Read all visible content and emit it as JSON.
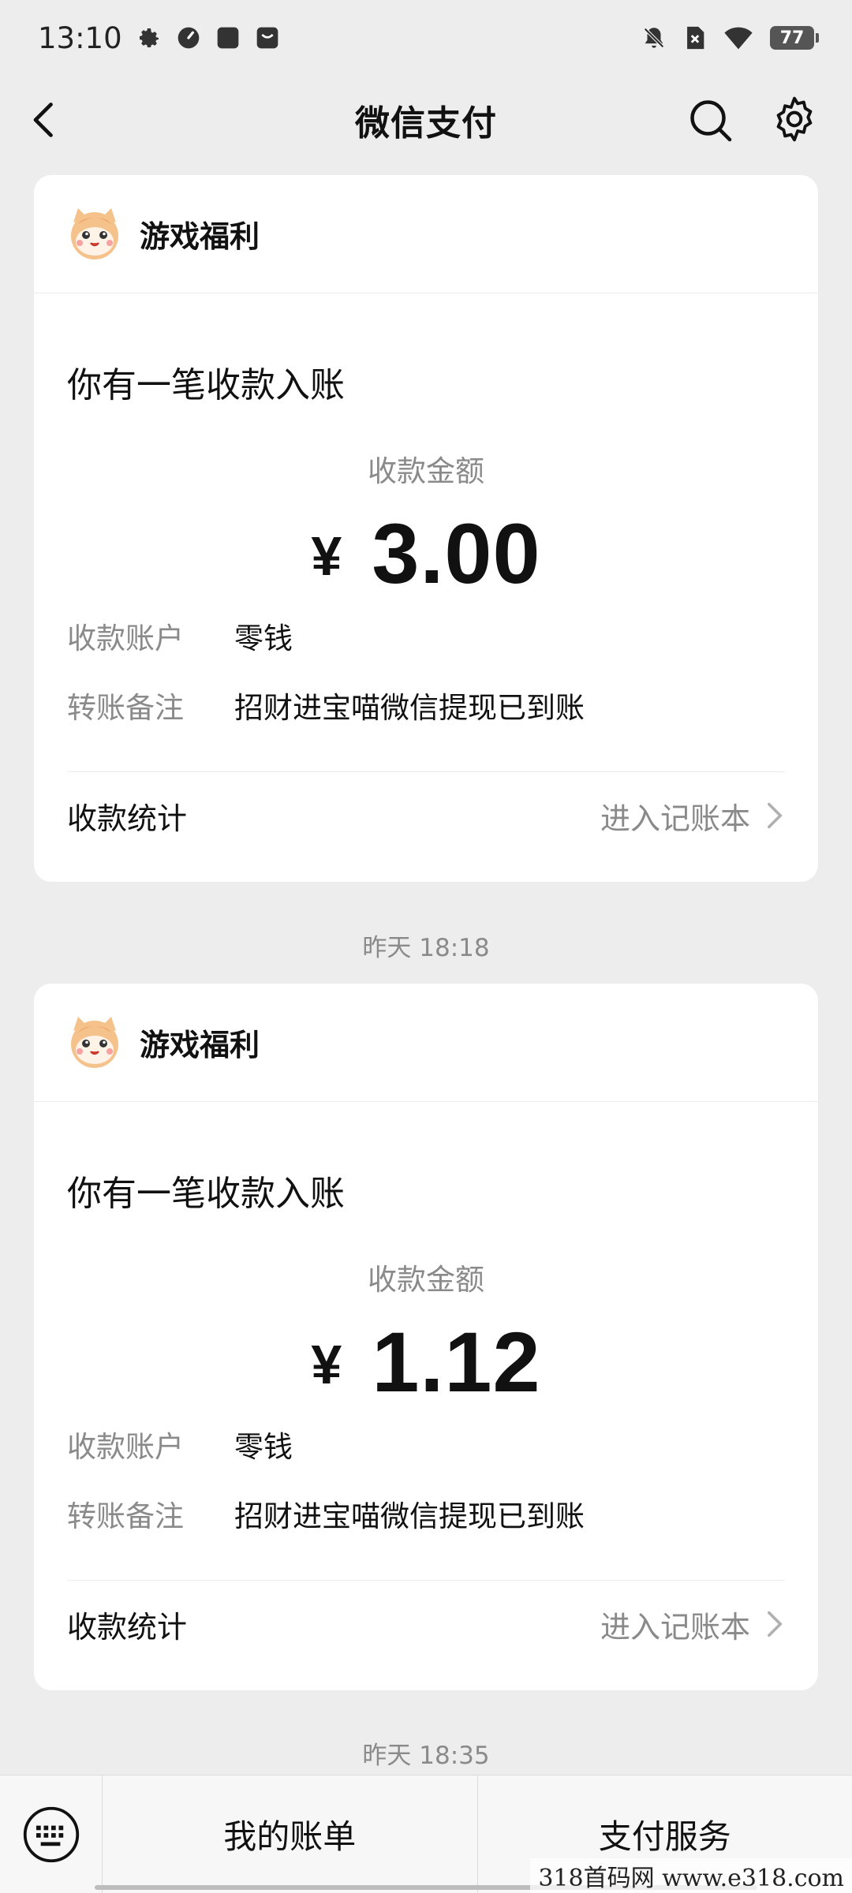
{
  "status_bar": {
    "time": "13:10",
    "battery": "77",
    "icons_left": [
      "gear-icon",
      "clock-icon",
      "app-icon",
      "mail-icon"
    ],
    "icons_right": [
      "mute-icon",
      "sim-icon",
      "wifi-icon",
      "battery-icon"
    ]
  },
  "nav": {
    "title": "微信支付",
    "back_icon": "chevron-left-icon",
    "search_icon": "search-icon",
    "settings_icon": "gear-icon"
  },
  "cards": [
    {
      "sender": "游戏福利",
      "headline": "你有一笔收款入账",
      "amount_label": "收款金额",
      "currency": "¥",
      "amount": "3.00",
      "rows": [
        {
          "key": "收款账户",
          "value": "零钱"
        },
        {
          "key": "转账备注",
          "value": "招财进宝喵微信提现已到账"
        }
      ],
      "stat_label": "收款统计",
      "link_label": "进入记账本"
    },
    {
      "sender": "游戏福利",
      "headline": "你有一笔收款入账",
      "amount_label": "收款金额",
      "currency": "¥",
      "amount": "1.12",
      "rows": [
        {
          "key": "收款账户",
          "value": "零钱"
        },
        {
          "key": "转账备注",
          "value": "招财进宝喵微信提现已到账"
        }
      ],
      "stat_label": "收款统计",
      "link_label": "进入记账本"
    }
  ],
  "timestamps": [
    "昨天 18:18",
    "昨天 18:35"
  ],
  "bottom_bar": {
    "keyboard_icon": "keyboard-icon",
    "tab1": "我的账单",
    "tab2": "支付服务"
  },
  "watermark": "318首码网  www.e318.com",
  "colors": {
    "background": "#ededed",
    "card": "#ffffff",
    "secondary_text": "#8a8a8a",
    "primary_text": "#111111"
  }
}
